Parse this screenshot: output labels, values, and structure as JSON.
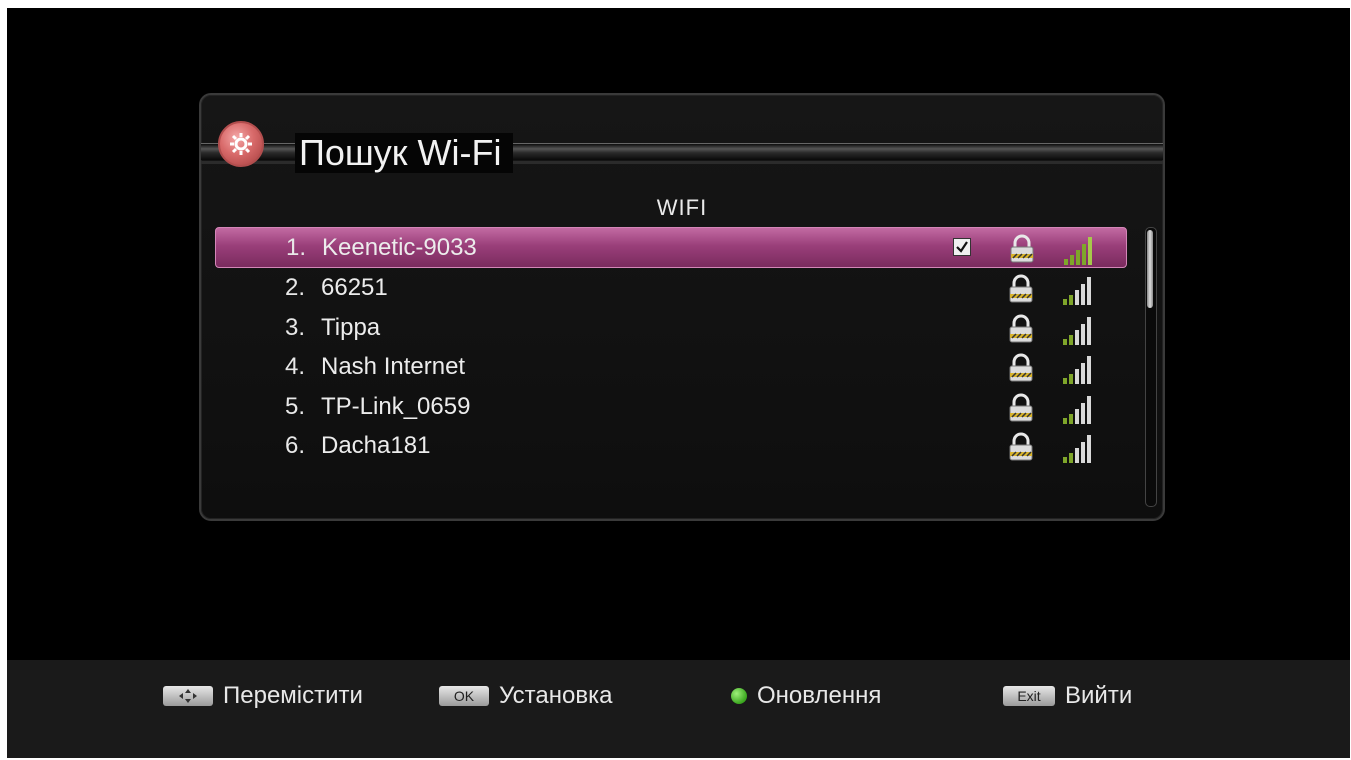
{
  "window": {
    "title": "Пошук Wi-Fi",
    "list_header": "WIFI"
  },
  "networks": [
    {
      "index": "1.",
      "name": "Keenetic-9033",
      "selected": true,
      "connected": true,
      "locked": true
    },
    {
      "index": "2.",
      "name": "66251",
      "selected": false,
      "connected": false,
      "locked": true
    },
    {
      "index": "3.",
      "name": "Tippa",
      "selected": false,
      "connected": false,
      "locked": true
    },
    {
      "index": "4.",
      "name": "Nash Internet",
      "selected": false,
      "connected": false,
      "locked": true
    },
    {
      "index": "5.",
      "name": "TP-Link_0659",
      "selected": false,
      "connected": false,
      "locked": true
    },
    {
      "index": "6.",
      "name": "Dacha181",
      "selected": false,
      "connected": false,
      "locked": true
    }
  ],
  "footer": {
    "move": {
      "key_icon": "arrows-icon",
      "label": "Перемістити"
    },
    "ok": {
      "key": "OK",
      "label": "Установка"
    },
    "refresh": {
      "key_icon": "green-dot",
      "label": "Оновлення"
    },
    "exit": {
      "key": "Exit",
      "label": "Вийти"
    }
  },
  "colors": {
    "highlight": "#9a3f7a",
    "signal_green": "#6a9a1e",
    "background": "#000000"
  }
}
